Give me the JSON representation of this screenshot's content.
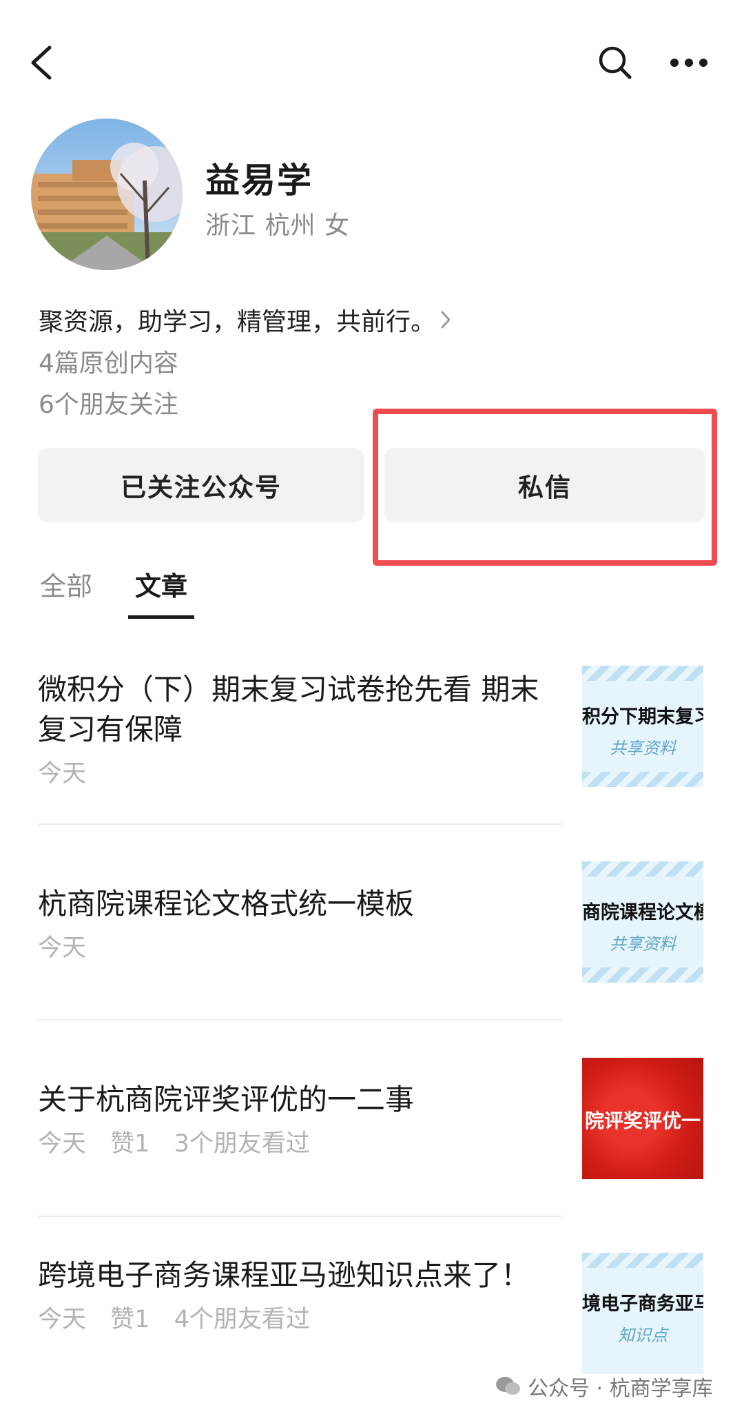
{
  "header": {
    "back_icon": "chevron-left-icon",
    "search_icon": "search-icon",
    "more_icon": "more-horizontal-icon"
  },
  "profile": {
    "name": "益易学",
    "meta": "浙江 杭州 女",
    "bio": "聚资源，助学习，精管理，共前行。",
    "original_count": "4篇原创内容",
    "friends_follow": "6个朋友关注"
  },
  "actions": {
    "follow_label": "已关注公众号",
    "message_label": "私信",
    "highlight_color": "#ee4c4f"
  },
  "tabs": [
    {
      "label": "全部"
    },
    {
      "label": "文章"
    }
  ],
  "articles": [
    {
      "title": "微积分（下）期末复习试卷抢先看 期末复习有保障",
      "date": "今天",
      "likes": "",
      "views": "",
      "thumb_text": "积分下期末复习",
      "thumb_sub": "共享资料"
    },
    {
      "title": "杭商院课程论文格式统一模板",
      "date": "今天",
      "likes": "",
      "views": "",
      "thumb_text": "商院课程论文模",
      "thumb_sub": "共享资料"
    },
    {
      "title": "关于杭商院评奖评优的一二事",
      "date": "今天",
      "likes": "赞1",
      "views": "3个朋友看过",
      "thumb_text": "院评奖评优一",
      "thumb_sub": ""
    },
    {
      "title": "跨境电子商务课程亚马逊知识点来了！",
      "date": "今天",
      "likes": "赞1",
      "views": "4个朋友看过",
      "thumb_text": "境电子商务亚马",
      "thumb_sub": "知识点"
    }
  ],
  "watermark": {
    "text": "公众号 · 杭商学享库"
  }
}
